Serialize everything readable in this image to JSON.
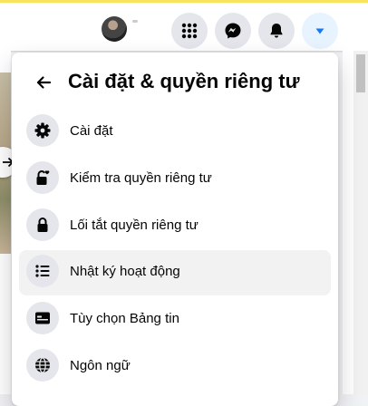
{
  "topbar": {
    "icons": [
      "avatar",
      "menu-grid-icon",
      "messenger-icon",
      "notifications-bell-icon",
      "account-dropdown-icon"
    ],
    "active_color": "#1877f2"
  },
  "panel": {
    "title": "Cài đặt & quyền riêng tư",
    "back_icon": "arrow-left-icon",
    "items": [
      {
        "label": "Cài đặt",
        "icon": "gear-icon"
      },
      {
        "label": "Kiểm tra quyền riêng tư",
        "icon": "lock-heart-icon"
      },
      {
        "label": "Lối tắt quyền riêng tư",
        "icon": "lock-icon"
      },
      {
        "label": "Nhật ký hoạt động",
        "icon": "list-icon",
        "highlighted": true
      },
      {
        "label": "Tùy chọn Bảng tin",
        "icon": "news-feed-icon"
      },
      {
        "label": "Ngôn ngữ",
        "icon": "globe-icon"
      }
    ]
  }
}
